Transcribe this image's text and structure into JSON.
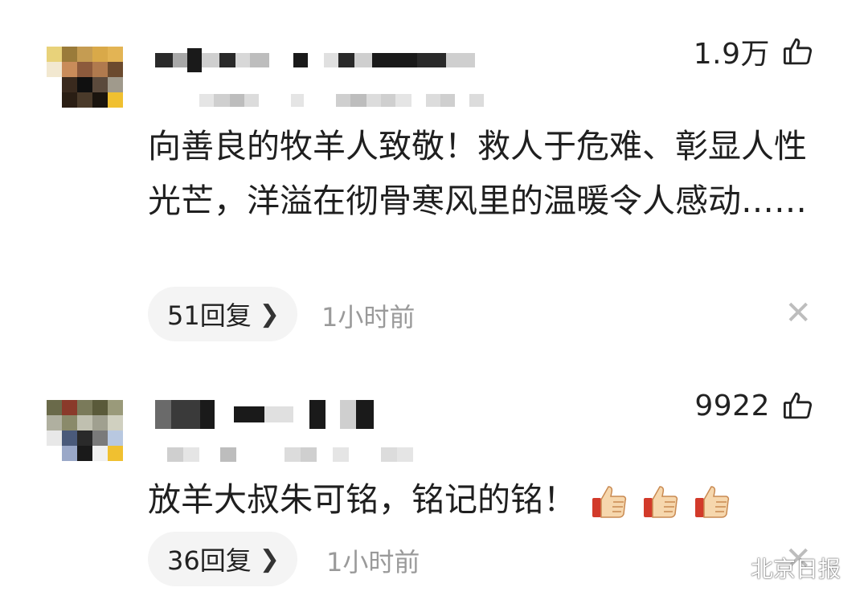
{
  "comments": [
    {
      "likes": "1.9万",
      "text": "向善良的牧羊人致敬！救人于危难、彰显人性光芒，洋溢在彻骨寒风里的温暖令人感动……",
      "replies": "51回复",
      "time": "1小时前"
    },
    {
      "likes": "9922",
      "text": "放羊大叔朱可铭，铭记的铭！",
      "replies": "36回复",
      "time": "1小时前"
    }
  ],
  "icons": {
    "like": "thumbs-up-outline-icon",
    "chevron": "chevron-right-icon",
    "close": "close-icon",
    "emoji": "thumbs-up-emoji-icon",
    "watermark": "wechat-icon"
  },
  "watermark": {
    "text": "北京日报"
  },
  "colors": {
    "text": "#1f1f1f",
    "meta": "#9a9a9a",
    "pill_bg": "#f4f4f4",
    "close": "#bdbdbd"
  }
}
